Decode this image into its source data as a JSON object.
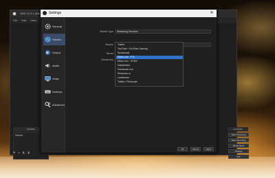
{
  "obs": {
    "title": "OBS 21.0.1 (64bit)",
    "menu": [
      "File",
      "Edit",
      "View",
      "Profile"
    ],
    "scenes_header": "Scenes",
    "scene_item": "Scene",
    "scene_controls": [
      "+",
      "−",
      "∧",
      "∨"
    ],
    "controls_header": "Controls",
    "controls": [
      "Start Streaming",
      "Start Recording",
      "Studio Mode",
      "Settings",
      "Exit"
    ]
  },
  "settings": {
    "title": "Settings",
    "close_label": "✕",
    "sidebar": [
      {
        "label": "General",
        "icon": "gear-icon"
      },
      {
        "label": "Stream",
        "icon": "globe-icon"
      },
      {
        "label": "Output",
        "icon": "output-icon"
      },
      {
        "label": "Audio",
        "icon": "speaker-icon"
      },
      {
        "label": "Video",
        "icon": "monitor-icon"
      },
      {
        "label": "Hotkeys",
        "icon": "keyboard-icon"
      },
      {
        "label": "Advanced",
        "icon": "wrench-icon"
      }
    ],
    "active_sidebar_item": "Stream",
    "stream_type_label": "Stream Type",
    "stream_type_value": "Streaming Services",
    "service_label": "Service",
    "service_value": "Twitch",
    "server_label": "Server",
    "stream_key_label": "Stream key",
    "service_options": [
      "Twitch",
      "YouTube / YouTube Gaming",
      "Smashcast",
      "Mixer.com - FTL",
      "Mixer.com - RTMP",
      "DailyMotion",
      "Facebook Live",
      "Restream.io",
      "Livestream",
      "Twitter / Periscope"
    ],
    "highlighted_option_index": 3,
    "buttons": {
      "ok": "OK",
      "cancel": "Cancel",
      "apply": "Apply"
    }
  }
}
